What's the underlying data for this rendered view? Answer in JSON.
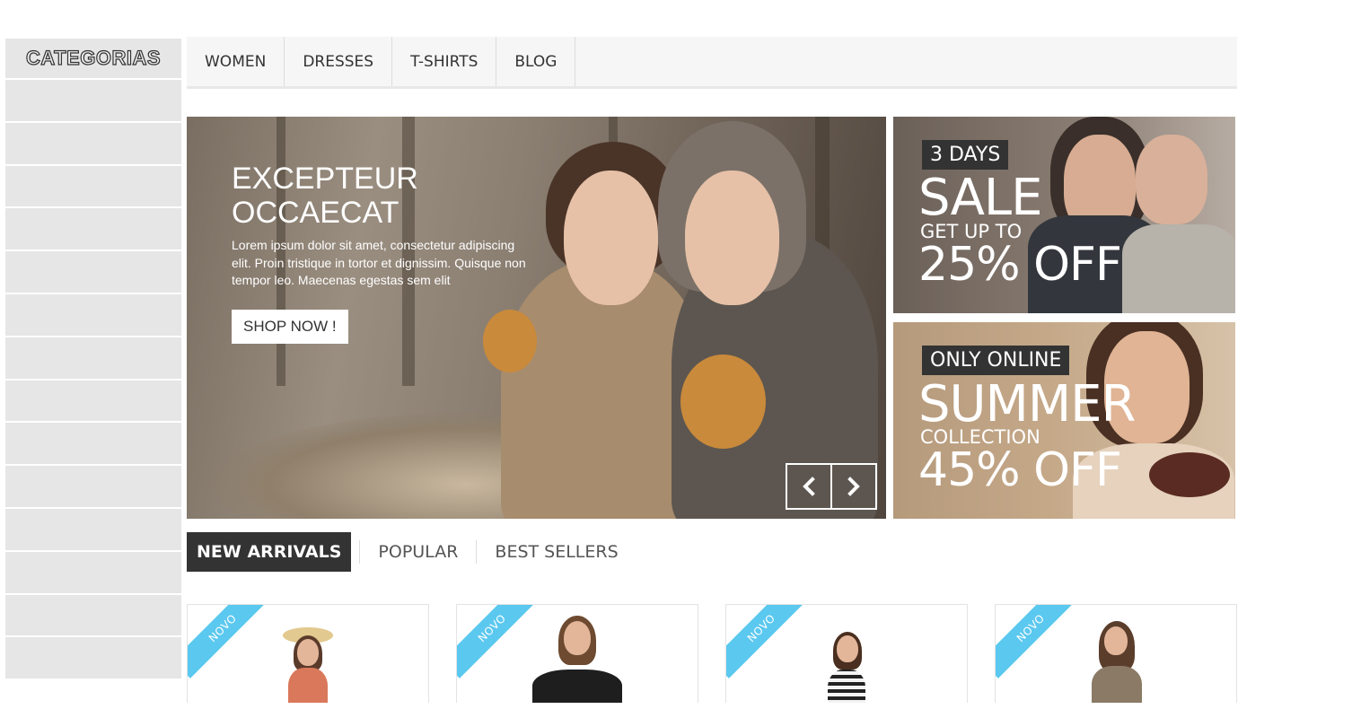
{
  "sidebar": {
    "header": "CATEGORIAS",
    "item_count": 14
  },
  "nav": {
    "items": [
      "WOMEN",
      "DRESSES",
      "T-SHIRTS",
      "BLOG"
    ]
  },
  "slider": {
    "title_line1": "EXCEPTEUR",
    "title_line2": "OCCAECAT",
    "text": "Lorem ipsum dolor sit amet, consectetur adipiscing elit. Proin tristique in tortor et dignissim. Quisque non tempor leo. Maecenas egestas sem elit",
    "button": "SHOP NOW !",
    "prev_icon": "chevron-left-icon",
    "next_icon": "chevron-right-icon"
  },
  "banners": {
    "top": {
      "tag": "3 DAYS",
      "big": "SALE",
      "small": "GET UP TO",
      "off": "25% OFF"
    },
    "bottom": {
      "tag": "ONLY ONLINE",
      "big": "SUMMER",
      "small": "COLLECTION",
      "off": "45% OFF"
    }
  },
  "tabs": {
    "items": [
      "NEW ARRIVALS",
      "POPULAR",
      "BEST SELLERS"
    ],
    "active": "NEW ARRIVALS"
  },
  "products": {
    "badge": "NOVO",
    "accent": "#5bc8ef"
  },
  "colors": {
    "dark": "#333333",
    "light_gray": "#e6e6e6",
    "nav_bg": "#f6f6f6"
  }
}
